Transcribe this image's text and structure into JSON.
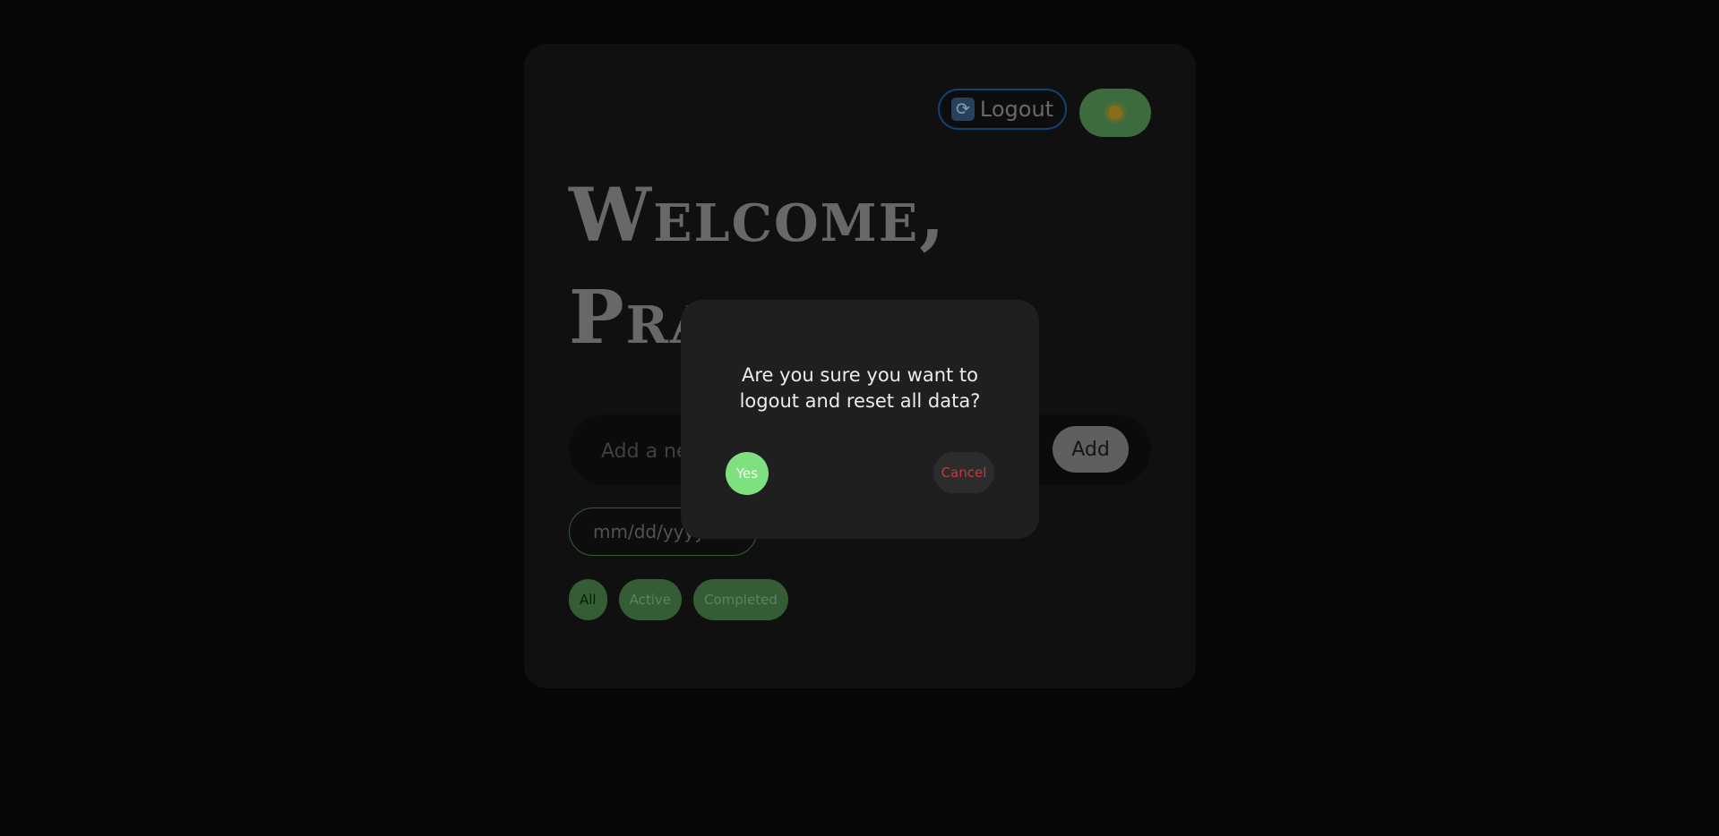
{
  "header": {
    "logout_label": "Logout",
    "logout_icon": "refresh-icon",
    "theme_icon": "sun-icon"
  },
  "main": {
    "welcome_line1": "Welcome,",
    "welcome_line2": "Prakhar",
    "task_input_placeholder": "Add a new task",
    "task_input_value": "",
    "add_label": "Add",
    "date_placeholder": "mm/dd/yyyy",
    "filters": [
      {
        "label": "All",
        "selected": true
      },
      {
        "label": "Active",
        "selected": false
      },
      {
        "label": "Completed",
        "selected": false
      }
    ]
  },
  "modal": {
    "message": "Are you sure you want to logout and reset all data?",
    "yes_label": "Yes",
    "cancel_label": "Cancel"
  },
  "colors": {
    "page_bg": "#0a0a0a",
    "card_bg": "#191919",
    "accent_green": "#5a9e5a",
    "logout_border": "#1f5fa8",
    "yes_green": "#7fe07f",
    "cancel_red": "#c33a3a"
  }
}
